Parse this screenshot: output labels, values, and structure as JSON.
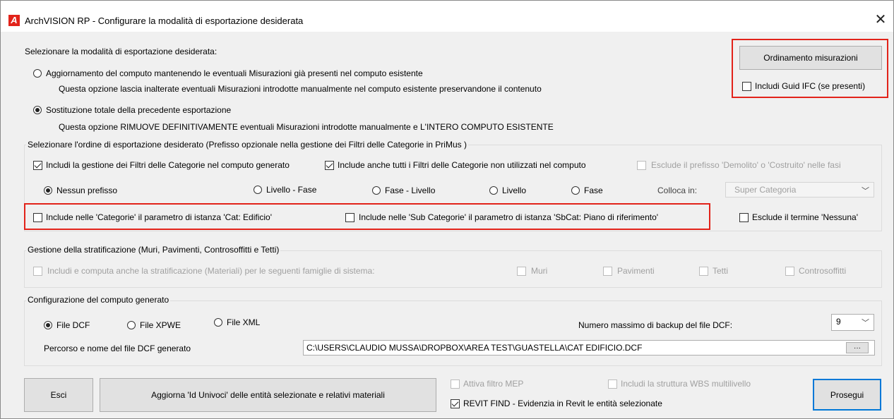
{
  "window": {
    "title": "ArchVISION RP - Configurare la modalità di esportazione desiderata",
    "icon_letter": "A",
    "close": "✕"
  },
  "mode": {
    "heading": "Selezionare la modalità di esportazione desiderata:",
    "opt1_label": "Aggiornamento del computo mantenendo le eventuali Misurazioni già presenti nel computo esistente",
    "opt1_desc": "Questa opzione lascia inalterate eventuali Misurazioni introdotte manualmente nel computo esistente preservandone il contenuto",
    "opt2_label": "Sostituzione totale della precedente esportazione",
    "opt2_desc": "Questa opzione RIMUOVE DEFINITIVAMENTE eventuali Misurazioni introdotte manualmente e L'INTERO COMPUTO ESISTENTE",
    "selected": 2
  },
  "side": {
    "ordinamento_button": "Ordinamento misurazioni",
    "guid_label": "Includi Guid IFC (se presenti)"
  },
  "order": {
    "legend": "Selezionare l'ordine di esportazione desiderato (Prefisso opzionale nella gestione dei Filtri delle Categorie in PriMus )",
    "filtri_label": "Includi la gestione dei Filtri delle Categorie nel computo generato",
    "filtri_unused_label": "Include anche tutti i Filtri delle Categorie non utilizzati nel computo",
    "esclude_prefisso_label": "Esclude il prefisso 'Demolito' o 'Costruito' nelle fasi",
    "prefix_none": "Nessun prefisso",
    "prefix_livello_fase": "Livello - Fase",
    "prefix_fase_livello": "Fase - Livello",
    "prefix_livello": "Livello",
    "prefix_fase": "Fase",
    "colloca_label": "Colloca in:",
    "colloca_value": "Super Categoria",
    "cat_edificio_label": "Include nelle 'Categorie' il parametro di istanza 'Cat: Edificio'",
    "subcat_label": "Include nelle 'Sub Categorie' il parametro di istanza 'SbCat: Piano di riferimento'",
    "esclude_nessuna_label": "Esclude il termine 'Nessuna'"
  },
  "strat": {
    "legend": "Gestione della stratificazione (Muri, Pavimenti, Controsoffitti e Tetti)",
    "include_label": "Includi e computa anche la stratificazione (Materiali) per le seguenti famiglie di sistema:",
    "muri": "Muri",
    "pavimenti": "Pavimenti",
    "tetti": "Tetti",
    "controsoffitti": "Controsoffitti"
  },
  "config": {
    "legend": "Configurazione del computo generato",
    "file_dcf": "File DCF",
    "file_xpwe": "File XPWE",
    "file_xml": "File XML",
    "backup_label": "Numero massimo di backup del file DCF:",
    "backup_value": "9",
    "path_label": "Percorso e nome del file DCF generato",
    "path_value": "C:\\USERS\\CLAUDIO MUSSA\\DROPBOX\\AREA TEST\\GUASTELLA\\CAT EDIFICIO.DCF",
    "browse": "···"
  },
  "footer": {
    "esci": "Esci",
    "aggiorna": "Aggiorna 'Id Univoci' delle entità selezionate e relativi materiali",
    "mep_label": "Attiva filtro MEP",
    "wbs_label": "Includi la struttura WBS multilivello",
    "revit_label": "REVIT FIND - Evidenzia in Revit le entità selezionate",
    "prosegui": "Prosegui"
  }
}
